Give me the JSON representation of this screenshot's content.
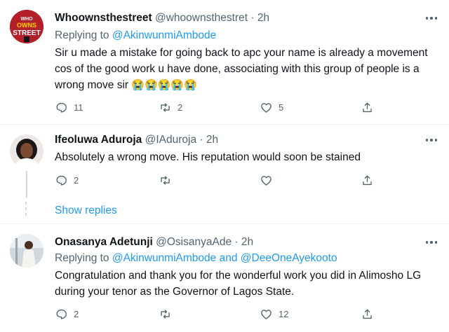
{
  "tweets": [
    {
      "name": "Whoownsthestreet",
      "handle": "@whoownsthestret",
      "time": "2h",
      "replying_label": "Replying to",
      "replying_to": "@AkinwunmiAmbode",
      "replying_and": "",
      "replying_to_2": "",
      "text": "Sir u made a mistake for going back to apc your name is already a movement cos of the good work u have done, associating with this group of people is a wrong move sir",
      "emojis": "😭😭😭😭😭",
      "replies": "11",
      "retweets": "2",
      "likes": "5",
      "avatar_text": "WHO OWNS THE STREET"
    },
    {
      "name": "Ifeoluwa Aduroja",
      "handle": "@IAduroja",
      "time": "2h",
      "text": "Absolutely a wrong move. His reputation would soon be stained",
      "replies": "2",
      "retweets": "",
      "likes": ""
    },
    {
      "name": "Onasanya Adetunji",
      "handle": "@OsisanyaAde",
      "time": "2h",
      "replying_label": "Replying to",
      "replying_to": "@AkinwunmiAmbode",
      "replying_and": "and",
      "replying_to_2": "@DeeOneAyekooto",
      "text": "Congratulation and thank you for the wonderful work you did in Alimosho LG during your tenor as the Governor of Lagos State.",
      "replies": "2",
      "retweets": "",
      "likes": "12"
    }
  ],
  "show_replies": "Show replies",
  "separator": "·",
  "colors": {
    "accent": "#1d9bf0",
    "muted": "#536471",
    "text": "#0f1419",
    "line": "#cfd9de"
  },
  "icons": [
    "reply-icon",
    "retweet-icon",
    "like-icon",
    "share-icon",
    "more-icon"
  ]
}
